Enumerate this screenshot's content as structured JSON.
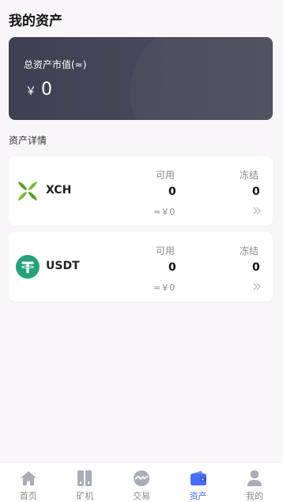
{
  "header": {
    "title": "我的资产"
  },
  "summary": {
    "label": "总资产市值(≈)",
    "currency": "￥",
    "value": "0"
  },
  "section": {
    "title": "资产详情"
  },
  "assets": [
    {
      "name": "XCH",
      "icon": "chia-leaf-icon",
      "available_label": "可用",
      "frozen_label": "冻结",
      "available": "0",
      "frozen": "0",
      "approx": "≈￥0"
    },
    {
      "name": "USDT",
      "icon": "tether-icon",
      "available_label": "可用",
      "frozen_label": "冻结",
      "available": "0",
      "frozen": "0",
      "approx": "≈￥0"
    }
  ],
  "tabbar": {
    "items": [
      {
        "label": "首页",
        "icon": "home-icon",
        "active": false
      },
      {
        "label": "矿机",
        "icon": "miner-icon",
        "active": false
      },
      {
        "label": "交易",
        "icon": "trade-icon",
        "active": false
      },
      {
        "label": "资产",
        "icon": "wallet-icon",
        "active": true
      },
      {
        "label": "我的",
        "icon": "user-icon",
        "active": false
      }
    ]
  },
  "colors": {
    "accent": "#4a6cf7",
    "card_dark": "#45475a",
    "tether_green": "#26a17b",
    "chia_green": "#5b9a2c"
  }
}
